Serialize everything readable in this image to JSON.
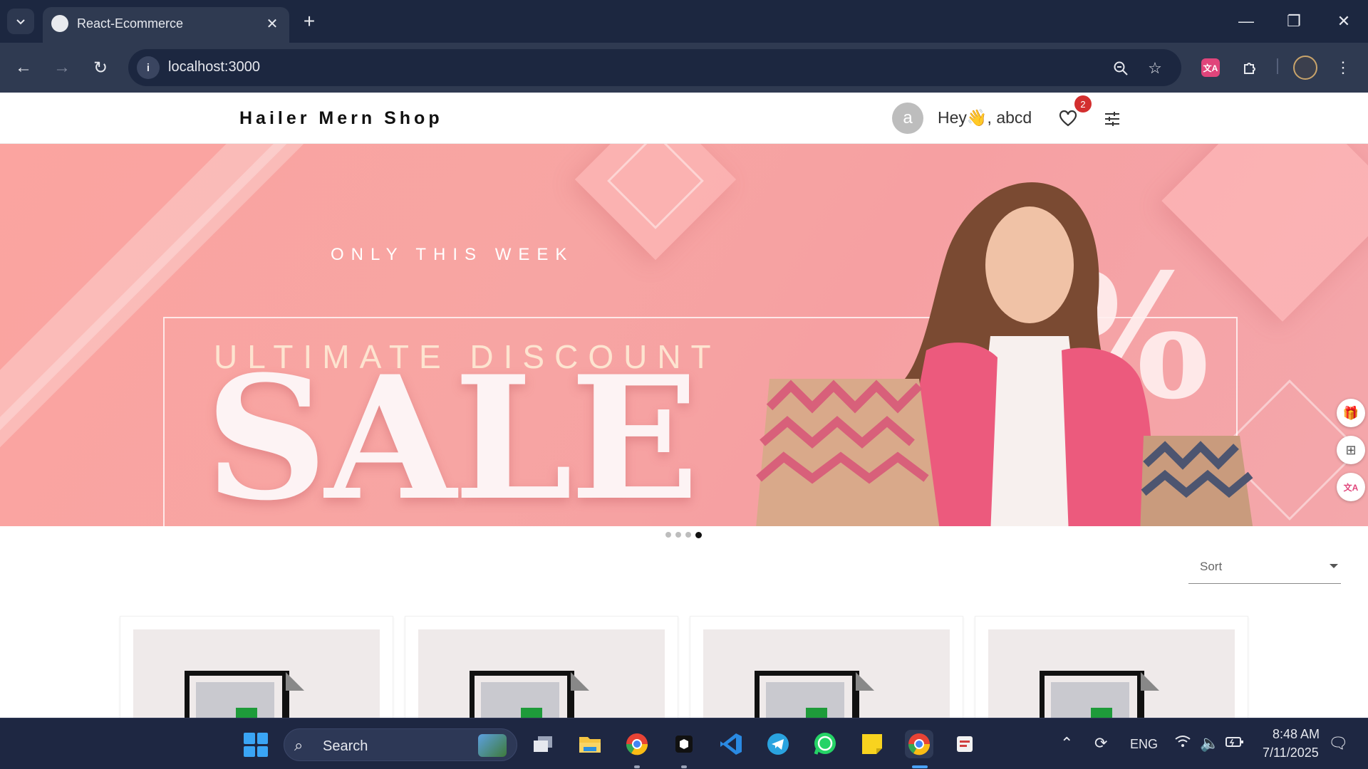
{
  "browser": {
    "tab_title": "React-Ecommerce",
    "url": "localhost:3000"
  },
  "site": {
    "brand": "Hailer Mern Shop",
    "avatar_letter": "a",
    "greeting": "Hey👋, abcd",
    "wishlist_count": "2"
  },
  "banner": {
    "kicker": "ONLY THIS WEEK",
    "subtitle": "ULTIMATE DISCOUNT",
    "headline": "SALE",
    "symbol": "%",
    "slides_total": 4,
    "active_slide": 4
  },
  "sort": {
    "label": "Sort"
  },
  "products": [
    {
      "id": 1
    },
    {
      "id": 2
    },
    {
      "id": 3
    },
    {
      "id": 4
    }
  ],
  "taskbar": {
    "search_label": "Search",
    "language": "ENG",
    "time": "8:48 AM",
    "date": "7/11/2025"
  },
  "colors": {
    "chrome_dark": "#1c2740",
    "chrome_toolbar": "#2f3a51",
    "banner_pink": "#f7a5a3",
    "badge_red": "#d32f2f",
    "taskbar": "#1e2742"
  }
}
